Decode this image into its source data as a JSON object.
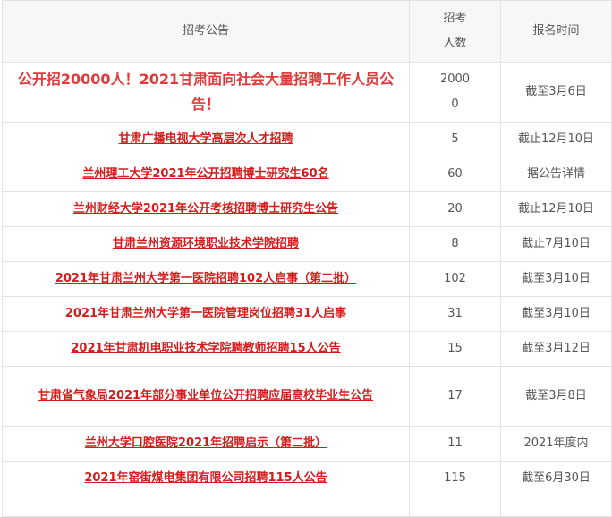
{
  "header": {
    "notice": "招考公告",
    "count": "招考人数",
    "deadline": "报名时间"
  },
  "rows": [
    {
      "title": "公开招20000人！2021甘肃面向社会大量招聘工作人员公告！",
      "count": "20000",
      "date": "截至3月6日"
    },
    {
      "title": "甘肃广播电视大学高层次人才招聘",
      "count": "5",
      "date": "截止12月10日"
    },
    {
      "title": "兰州理工大学2021年公开招聘博士研究生60名",
      "count": "60",
      "date": "据公告详情"
    },
    {
      "title": "兰州财经大学2021年公开考核招聘博士研究生公告",
      "count": "20",
      "date": "截止12月10日"
    },
    {
      "title": "甘肃兰州资源环境职业技术学院招聘",
      "count": "8",
      "date": "截止7月10日"
    },
    {
      "title": "2021年甘肃兰州大学第一医院招聘102人启事（第二批）",
      "count": "102",
      "date": "截至3月10日"
    },
    {
      "title": "2021年甘肃兰州大学第一医院管理岗位招聘31人启事",
      "count": "31",
      "date": "截至3月10日"
    },
    {
      "title": "2021年甘肃机电职业技术学院聘教师招聘15人公告",
      "count": "15",
      "date": "截至3月12日"
    },
    {
      "title": "甘肃省气象局2021年部分事业单位公开招聘应届高校毕业生公告",
      "count": "17",
      "date": "截至3月8日"
    },
    {
      "title": "兰州大学口腔医院2021年招聘启示（第二批）",
      "count": "11",
      "date": "2021年度内"
    },
    {
      "title": "2021年窑街煤电集团有限公司招聘115人公告",
      "count": "115",
      "date": "截至6月30日"
    },
    {
      "title": "",
      "count": "",
      "date": ""
    }
  ]
}
